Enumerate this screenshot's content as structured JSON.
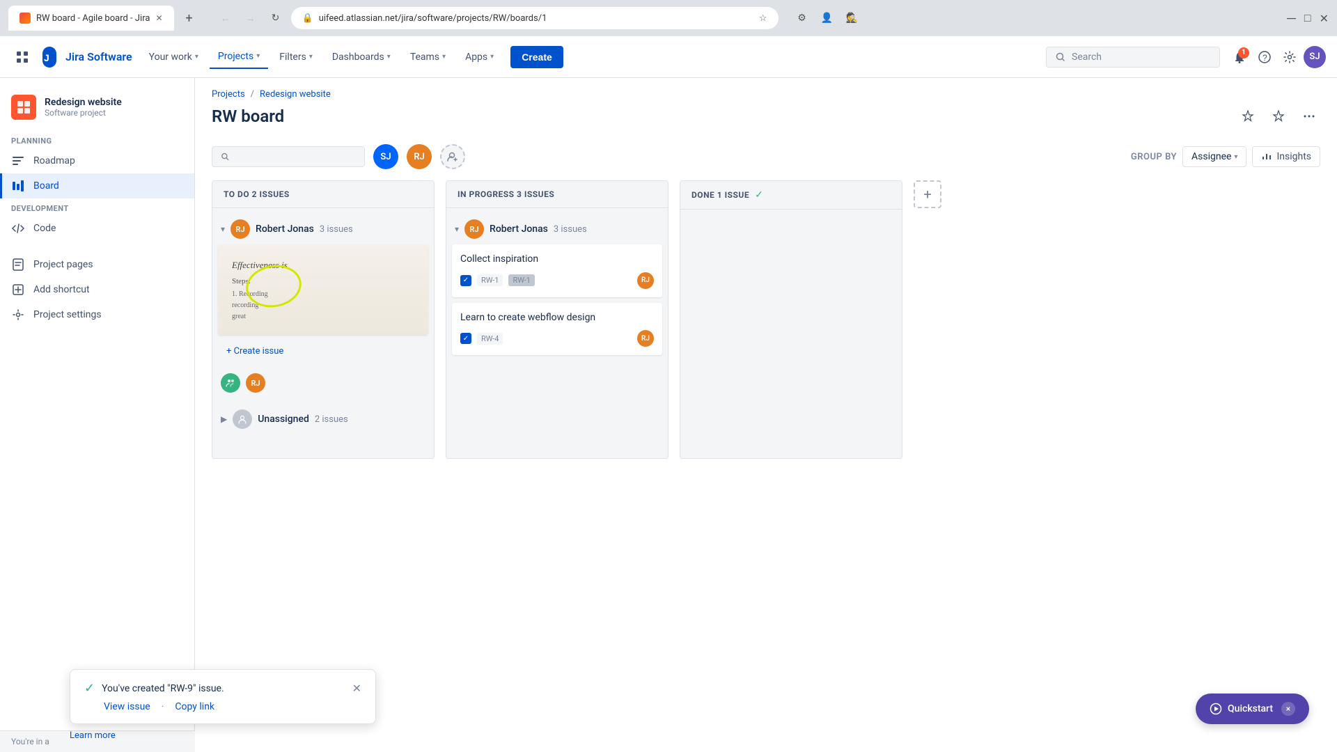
{
  "browser": {
    "tab_title": "RW board - Agile board - Jira",
    "url": "uifeed.atlassian.net/jira/software/projects/RW/boards/1",
    "new_tab_label": "+",
    "back_label": "←",
    "forward_label": "→",
    "refresh_label": "↻"
  },
  "topnav": {
    "logo_text": "Jira Software",
    "your_work": "Your work",
    "projects": "Projects",
    "filters": "Filters",
    "dashboards": "Dashboards",
    "teams": "Teams",
    "apps": "Apps",
    "create_label": "Create",
    "search_placeholder": "Search",
    "notification_count": "1",
    "avatar_initials": "SJ"
  },
  "sidebar": {
    "project_name": "Redesign website",
    "project_type": "Software project",
    "planning_label": "PLANNING",
    "roadmap_label": "Roadmap",
    "board_label": "Board",
    "development_label": "DEVELOPMENT",
    "code_label": "Code",
    "project_pages_label": "Project pages",
    "add_shortcut_label": "Add shortcut",
    "project_settings_label": "Project settings",
    "youre_in": "You're in a",
    "learn_more": "Learn more"
  },
  "breadcrumb": {
    "projects": "Projects",
    "separator": "/",
    "project_name": "Redesign website"
  },
  "page": {
    "title": "RW board"
  },
  "board_controls": {
    "group_by_label": "GROUP BY",
    "group_by_value": "Assignee",
    "insights_label": "Insights",
    "search_placeholder": ""
  },
  "assignee_filters": {
    "sj_initials": "SJ",
    "rj_initials": "RJ",
    "add_label": "+"
  },
  "columns": {
    "todo": {
      "title": "TO DO 2 ISSUES"
    },
    "in_progress": {
      "title": "IN PROGRESS 3 ISSUES"
    },
    "done": {
      "title": "DONE 1 ISSUE"
    }
  },
  "assignee_group": {
    "name": "Robert Jonas",
    "initials": "RJ",
    "count": "3 issues"
  },
  "in_progress_cards": [
    {
      "title": "Collect inspiration",
      "id": "RW-1",
      "id_badge": "RW-1",
      "assignee": "RJ"
    },
    {
      "title": "Learn to create webflow design",
      "id": "RW-4",
      "assignee": "RJ"
    }
  ],
  "todo_card": {
    "create_issue": "+ Create issue"
  },
  "unassigned_group": {
    "label": "Unassigned",
    "count": "2 issues"
  },
  "toast": {
    "message": "You've created \"RW-9\" issue.",
    "view_issue": "View issue",
    "separator": "·",
    "copy_link": "Copy link"
  },
  "quickstart": {
    "label": "Quickstart",
    "close": "×"
  }
}
